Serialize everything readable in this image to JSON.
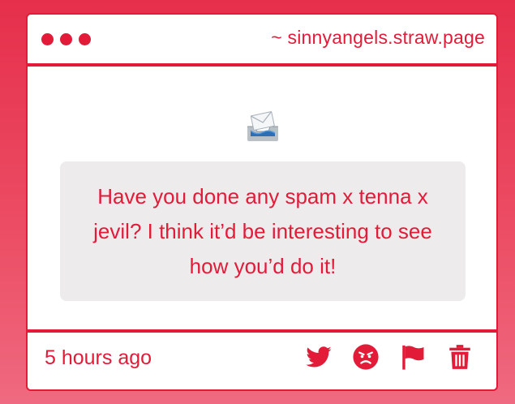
{
  "window": {
    "url": "~ sinnyangels.straw.page",
    "window_controls": [
      "close-dot",
      "minimize-dot",
      "maximize-dot"
    ]
  },
  "message": {
    "icon": "incoming-envelope-icon",
    "text": "Have you done any spam x tenna x jevil? I think it’d be interesting to see how you’d do it!"
  },
  "footer": {
    "timestamp": "5 hours ago",
    "actions": [
      "twitter-icon",
      "angry-face-icon",
      "flag-icon",
      "trash-icon"
    ]
  },
  "colors": {
    "accent": "#e21b38",
    "message_bg": "#edebec",
    "background_top": "#e62f4b",
    "background_bottom": "#ef6a80"
  }
}
